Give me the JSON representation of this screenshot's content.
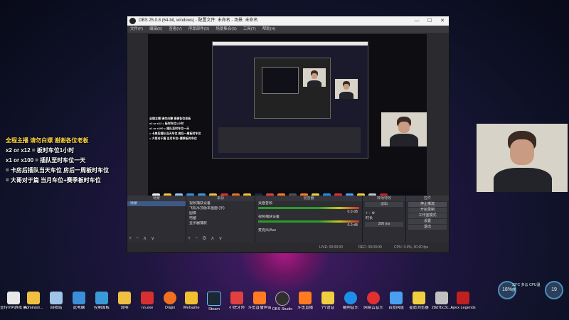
{
  "obs": {
    "title": "OBS 25.0.8 (64-bit, windows) - 配置文件: 未命名 - 场景: 未命名",
    "menu": [
      "文件(F)",
      "编辑(E)",
      "查看(V)",
      "停靠部件(D)",
      "场景集合(S)",
      "工具(T)",
      "帮助(H)"
    ],
    "window_buttons": [
      "—",
      "☐",
      "✕"
    ],
    "docks": {
      "scenes": {
        "header": "场景",
        "items": [
          "场景"
        ]
      },
      "sources": {
        "header": "来源",
        "items": [
          "视频捕获设备",
          "飞机吊顶版本画面 (示)",
          "图像",
          "电脑",
          "显示器捕获"
        ]
      },
      "mixer": {
        "header": "混音器",
        "channels": [
          {
            "name": "桌面音频",
            "db": "0.0 dB"
          },
          {
            "name": "视频捕获设备",
            "db": "0.0 dB"
          },
          {
            "name": "麦克风/Aux",
            "db": "0.0 dB"
          }
        ]
      },
      "transitions": {
        "header": "转场特效",
        "type": "淡出",
        "duration_label": "时长",
        "duration": "300 ms"
      },
      "controls": {
        "header": "控件",
        "buttons": [
          "停止推流",
          "开始录制",
          "工作室模式",
          "设置",
          "退出"
        ]
      }
    },
    "status": {
      "live": "LIVE: 00:00:00",
      "rec": "REC: 00:00:00",
      "cpu": "CPU: 3.4%, 30.00 fps"
    }
  },
  "overlay": {
    "lines": [
      "全程主播 请勿白嫖 谢谢各位老板",
      "x2 or x12 = 板时车位1小时",
      "x1 or x100 = 插队至时车位一天",
      "= 卡房后插队当天车位 房后一周板时车位",
      "= 大哥对于篇 当月车位+赛季板时车位"
    ]
  },
  "desktop_icons": [
    {
      "label": "宣传VIP游戏 链接.txt",
      "color": "#e8e8e8"
    },
    {
      "label": "Administr...",
      "color": "#f0c040"
    },
    {
      "label": "回收站",
      "color": "#9fc4e8"
    },
    {
      "label": "此电脑",
      "color": "#3a8fd8"
    },
    {
      "label": "控制面板",
      "color": "#3a9ad8"
    },
    {
      "label": "说明",
      "color": "#f0c040"
    },
    {
      "label": "nn.exe",
      "color": "#d83030"
    },
    {
      "label": "Origin",
      "color": "#f07020"
    },
    {
      "label": "WeGame",
      "color": "#f0c030"
    },
    {
      "label": "Steam",
      "color": "#1b2838"
    },
    {
      "label": "小虎牙师",
      "color": "#e04040"
    },
    {
      "label": "斗鱼直播伴侣",
      "color": "#ff7a20"
    },
    {
      "label": "OBS Studio",
      "color": "#302e31"
    },
    {
      "label": "斗鱼直播",
      "color": "#ff7a20"
    },
    {
      "label": "YY语音",
      "color": "#f0d040"
    },
    {
      "label": "酷狗音乐",
      "color": "#1e8fe8"
    },
    {
      "label": "网易云音乐",
      "color": "#e03030"
    },
    {
      "label": "百度网盘",
      "color": "#4aa0f0"
    },
    {
      "label": "星愿浏览器",
      "color": "#f0d040"
    },
    {
      "label": "28d7bc3c...",
      "color": "#c0c0c0"
    },
    {
      "label": "Apex Legends",
      "color": "#c02020"
    }
  ],
  "widgets": {
    "gauge1": "18%",
    "gauge2": "19",
    "weather": "33°C 多云 CPU温度"
  }
}
